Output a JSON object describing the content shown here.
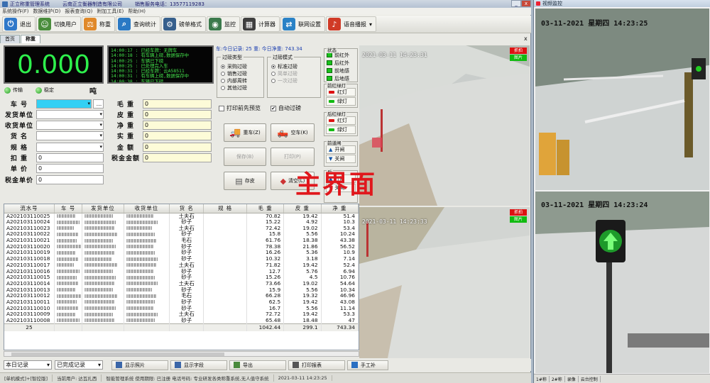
{
  "window": {
    "title": "正立称重管理系统",
    "company": "云南正立衡器制造有限公司",
    "hotline": "销售服务电话：13577119283",
    "minimize": "_",
    "close": "x"
  },
  "menu": [
    "系统操作(F)",
    "数据维护(D)",
    "报表查询(Q)",
    "附加工具(E)",
    "帮助(H)"
  ],
  "toolbar": [
    {
      "label": "退出",
      "icon": "power-icon",
      "color": "#2f78c9",
      "glyph": "⏻"
    },
    {
      "label": "切换用户",
      "icon": "users-icon",
      "color": "#4a8d3c",
      "glyph": "☺"
    },
    {
      "label": "称重",
      "icon": "scale-icon",
      "color": "#e0892a",
      "glyph": "⚖"
    },
    {
      "label": "查询统计",
      "icon": "search-icon",
      "color": "#2a79c4",
      "glyph": "⌕"
    },
    {
      "label": "磅单格式",
      "icon": "gear-icon",
      "color": "#365f8c",
      "glyph": "⚙"
    },
    {
      "label": "监控",
      "icon": "camera-icon",
      "color": "#3b7a4c",
      "glyph": "◉"
    },
    {
      "label": "计算器",
      "icon": "calculator-icon",
      "color": "#3f3f3f",
      "glyph": "▦"
    },
    {
      "label": "联网设置",
      "icon": "network-icon",
      "color": "#2a82c6",
      "glyph": "⇄"
    },
    {
      "label": "语音播报",
      "icon": "speaker-icon",
      "color": "#d03a26",
      "glyph": "♪"
    }
  ],
  "tabs": [
    "首页",
    "称重"
  ],
  "tab_close": "x",
  "weight": {
    "value": "0.000",
    "unit": "吨",
    "led1": "传输",
    "led2": "稳定"
  },
  "log_lines": [
    "14:00:17 : 已经车牌：无牌车",
    "14:00:18 : 有车辆上磅,数据保存中",
    "14:00:25 : 车辆已下磅",
    "14:00:25 : 已处理完入车",
    "14:00:31 : 已经车牌：云A58511",
    "14:00:31 : 有车辆上磅,数据保存中",
    "14:00:38 : 车辆已下磅"
  ],
  "stats": "车:今日记录: 25 重: 今日净重: 743.34",
  "filter_type": {
    "title": "过磅类型",
    "options": [
      {
        "label": "采购过磅",
        "on": true
      },
      {
        "label": "销售过磅",
        "on": false
      },
      {
        "label": "内部周转",
        "on": false
      },
      {
        "label": "其他过磅",
        "on": false
      }
    ]
  },
  "filter_mode": {
    "title": "过磅模式",
    "options": [
      {
        "label": "标准过磅",
        "on": true,
        "dis": false
      },
      {
        "label": "简单过磅",
        "on": false,
        "dis": true
      },
      {
        "label": "一次过磅",
        "on": false,
        "dis": true
      }
    ]
  },
  "checks": [
    {
      "label": "打印前先预览",
      "on": false
    },
    {
      "label": "自动过磅",
      "on": true
    }
  ],
  "action_buttons": {
    "heavy": "重车(Z)",
    "empty": "空车(K)",
    "save": "保存(B)",
    "print": "打印(P)",
    "store": "存皮",
    "clear": "清空(L)"
  },
  "form": {
    "left": [
      {
        "label": "车 号",
        "value": ""
      },
      {
        "label": "发货单位",
        "value": ""
      },
      {
        "label": "收货单位",
        "value": ""
      },
      {
        "label": "货 名",
        "value": ""
      },
      {
        "label": "规 格",
        "value": ""
      },
      {
        "label": "扣 重",
        "value": "0"
      },
      {
        "label": "单 价",
        "value": "0"
      },
      {
        "label": "税金单价",
        "value": "0"
      }
    ],
    "right": [
      {
        "label": "毛 重",
        "value": "0"
      },
      {
        "label": "皮 重",
        "value": "0"
      },
      {
        "label": "净 重",
        "value": "0"
      },
      {
        "label": "实 重",
        "value": "0"
      },
      {
        "label": "金 额",
        "value": "0"
      },
      {
        "label": "税金金额",
        "value": "0"
      }
    ],
    "browse": "..."
  },
  "side": {
    "status_title": "状态",
    "status": [
      "前红外",
      "后红外",
      "前地感",
      "后地感"
    ],
    "front_light_title": "前红绿灯",
    "back_light_title": "后红绿灯",
    "lights": [
      "红灯",
      "绿灯"
    ],
    "gate_title": "前道闸",
    "gate": [
      "开闸",
      "关闸"
    ],
    "back_gate_title": "后"
  },
  "camera": {
    "ts1": "2021-03-11  14:23:31",
    "ts2": "2021-03-11  14:23:33",
    "cap": "抓拍",
    "pic": "图片"
  },
  "watermark": "主界面",
  "table": {
    "headers": [
      "流水号",
      "车 号",
      "发货单位",
      "收货单位",
      "货 名",
      "规 格",
      "毛 重",
      "皮 重",
      "净 重"
    ],
    "rows": [
      [
        "A202103110025",
        "土夫石",
        "70.82",
        "19.42",
        "51.4"
      ],
      [
        "A202103110024",
        "砂子",
        "15.22",
        "4.92",
        "10.3"
      ],
      [
        "A202103110023",
        "土夫石",
        "72.42",
        "19.02",
        "53.4"
      ],
      [
        "A202103110022",
        "砂子",
        "15.8",
        "5.56",
        "10.24"
      ],
      [
        "A202103110021",
        "毛石",
        "61.76",
        "18.38",
        "43.38"
      ],
      [
        "A202103110020",
        "砂子",
        "78.38",
        "21.86",
        "56.52"
      ],
      [
        "A202103110019",
        "砂子",
        "16.26",
        "5.36",
        "10.9"
      ],
      [
        "A202103110018",
        "砂子",
        "10.32",
        "3.18",
        "7.14"
      ],
      [
        "A202103110017",
        "土夫石",
        "71.82",
        "19.42",
        "52.4"
      ],
      [
        "A202103110016",
        "砂子",
        "12.7",
        "5.76",
        "6.94"
      ],
      [
        "A202103110015",
        "砂子",
        "15.26",
        "4.5",
        "10.76"
      ],
      [
        "A202103110014",
        "土夫石",
        "73.66",
        "19.02",
        "54.64"
      ],
      [
        "A202103110013",
        "砂子",
        "15.9",
        "5.56",
        "10.34"
      ],
      [
        "A202103110012",
        "毛石",
        "66.28",
        "19.32",
        "46.96"
      ],
      [
        "A202103110011",
        "砂子",
        "62.5",
        "19.42",
        "43.08"
      ],
      [
        "A202103110010",
        "砂子",
        "16.7",
        "5.56",
        "11.14"
      ],
      [
        "A202103110009",
        "土夫石",
        "72.72",
        "19.42",
        "53.3"
      ],
      [
        "A202103110008",
        "砂子",
        "65.48",
        "18.48",
        "47"
      ]
    ],
    "summary": {
      "count": "25",
      "gross": "1042.44",
      "tare": "299.1",
      "net": "743.34"
    }
  },
  "bottom": {
    "range": "本日记录",
    "state": "已完成记录",
    "buttons": [
      "显示照片",
      "显示字段",
      "导出",
      "打印报表",
      "手工补"
    ]
  },
  "status": [
    "[单机模式]+[智控版]",
    "当前用户: 达瓦扎西",
    "智能管理系统 使用期限: 已注册 电话号码: 专业研发各类称重系统,无人值守系统",
    "2021-03-11 14:23:25"
  ],
  "monitor": {
    "title": "视频监控",
    "ts1": "03-11-2021  星期四  14:23:25",
    "ts2": "03-11-2021  星期四  14:23:24",
    "status": [
      "1#称",
      "2#称",
      "录像",
      "云台控制"
    ]
  }
}
